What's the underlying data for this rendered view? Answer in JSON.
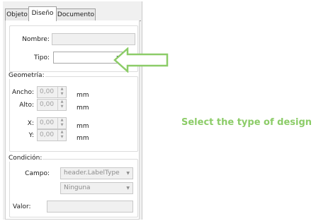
{
  "tabs": [
    {
      "label": "Objeto"
    },
    {
      "label": "Diseño"
    },
    {
      "label": "Documento"
    }
  ],
  "form": {
    "nombre_label": "Nombre:",
    "nombre_value": "",
    "tipo_label": "Tipo:",
    "tipo_value": ""
  },
  "geometria": {
    "title": "Geometría:",
    "fields": [
      {
        "label": "Ancho:",
        "value": "0,00",
        "unit": "mm"
      },
      {
        "label": "Alto:",
        "value": "0,00",
        "unit": "mm"
      },
      {
        "label": "X:",
        "value": "0,00",
        "unit": "mm"
      },
      {
        "label": "Y:",
        "value": "0,00",
        "unit": "mm"
      }
    ]
  },
  "condicion": {
    "title": "Condición:",
    "campo_label": "Campo:",
    "campo_value": "header.LabelType",
    "operator_value": "Ninguna",
    "valor_label": "Valor:",
    "valor_value": ""
  },
  "annotation": {
    "caption": "Select the type of design",
    "color": "#8ccc68"
  },
  "icons": [
    "spin-up-arrow",
    "spin-down-arrow",
    "dropdown-chevron",
    "pointer-arrow"
  ]
}
